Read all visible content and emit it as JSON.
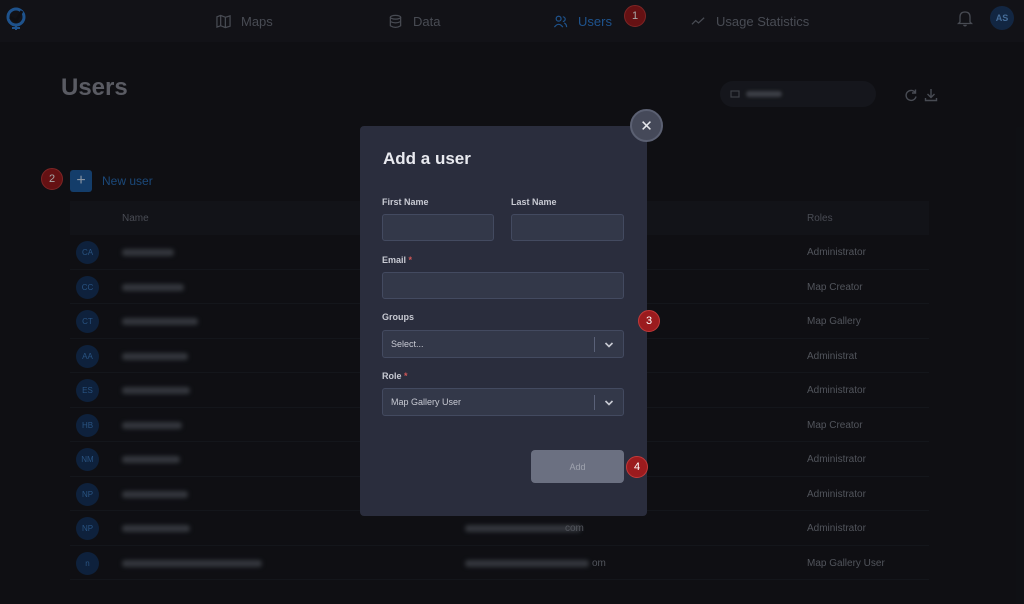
{
  "nav": {
    "items": [
      {
        "label": "Maps",
        "icon": "map-icon"
      },
      {
        "label": "Data",
        "icon": "database-icon"
      },
      {
        "label": "Users",
        "icon": "users-icon",
        "active": true
      },
      {
        "label": "Usage Statistics",
        "icon": "trend-icon"
      }
    ],
    "user_initials": "AS"
  },
  "page": {
    "title": "Users",
    "new_user_label": "New user",
    "columns": {
      "name": "Name",
      "roles": "Roles"
    },
    "rows": [
      {
        "initials": "CA",
        "email": "",
        "role": "Administrator"
      },
      {
        "initials": "CC",
        "email": "",
        "role": "Map Creator"
      },
      {
        "initials": "CT",
        "email": "",
        "role": "Map Gallery"
      },
      {
        "initials": "AA",
        "email": "",
        "role": "Administrat"
      },
      {
        "initials": "ES",
        "email": "",
        "role": "Administrator"
      },
      {
        "initials": "HB",
        "email": "",
        "role": "Map Creator"
      },
      {
        "initials": "NM",
        "email": "",
        "role": "Administrator"
      },
      {
        "initials": "NP",
        "email": "",
        "role": "Administrator"
      },
      {
        "initials": "NP",
        "email": "com",
        "role": "Administrator"
      },
      {
        "initials": "n",
        "email": "om",
        "role": "Map Gallery User"
      }
    ]
  },
  "modal": {
    "title": "Add a user",
    "first_name_label": "First Name",
    "last_name_label": "Last Name",
    "email_label": "Email",
    "required_mark": "*",
    "groups_label": "Groups",
    "groups_value": "Select...",
    "role_label": "Role",
    "role_value": "Map Gallery User",
    "add_label": "Add",
    "close_glyph": "✕"
  },
  "annotations": [
    "1",
    "2",
    "3",
    "4"
  ],
  "colors": {
    "accent": "#2f7fd8",
    "badge": "#9b1b1e",
    "modal_bg": "#2a2d3d"
  }
}
